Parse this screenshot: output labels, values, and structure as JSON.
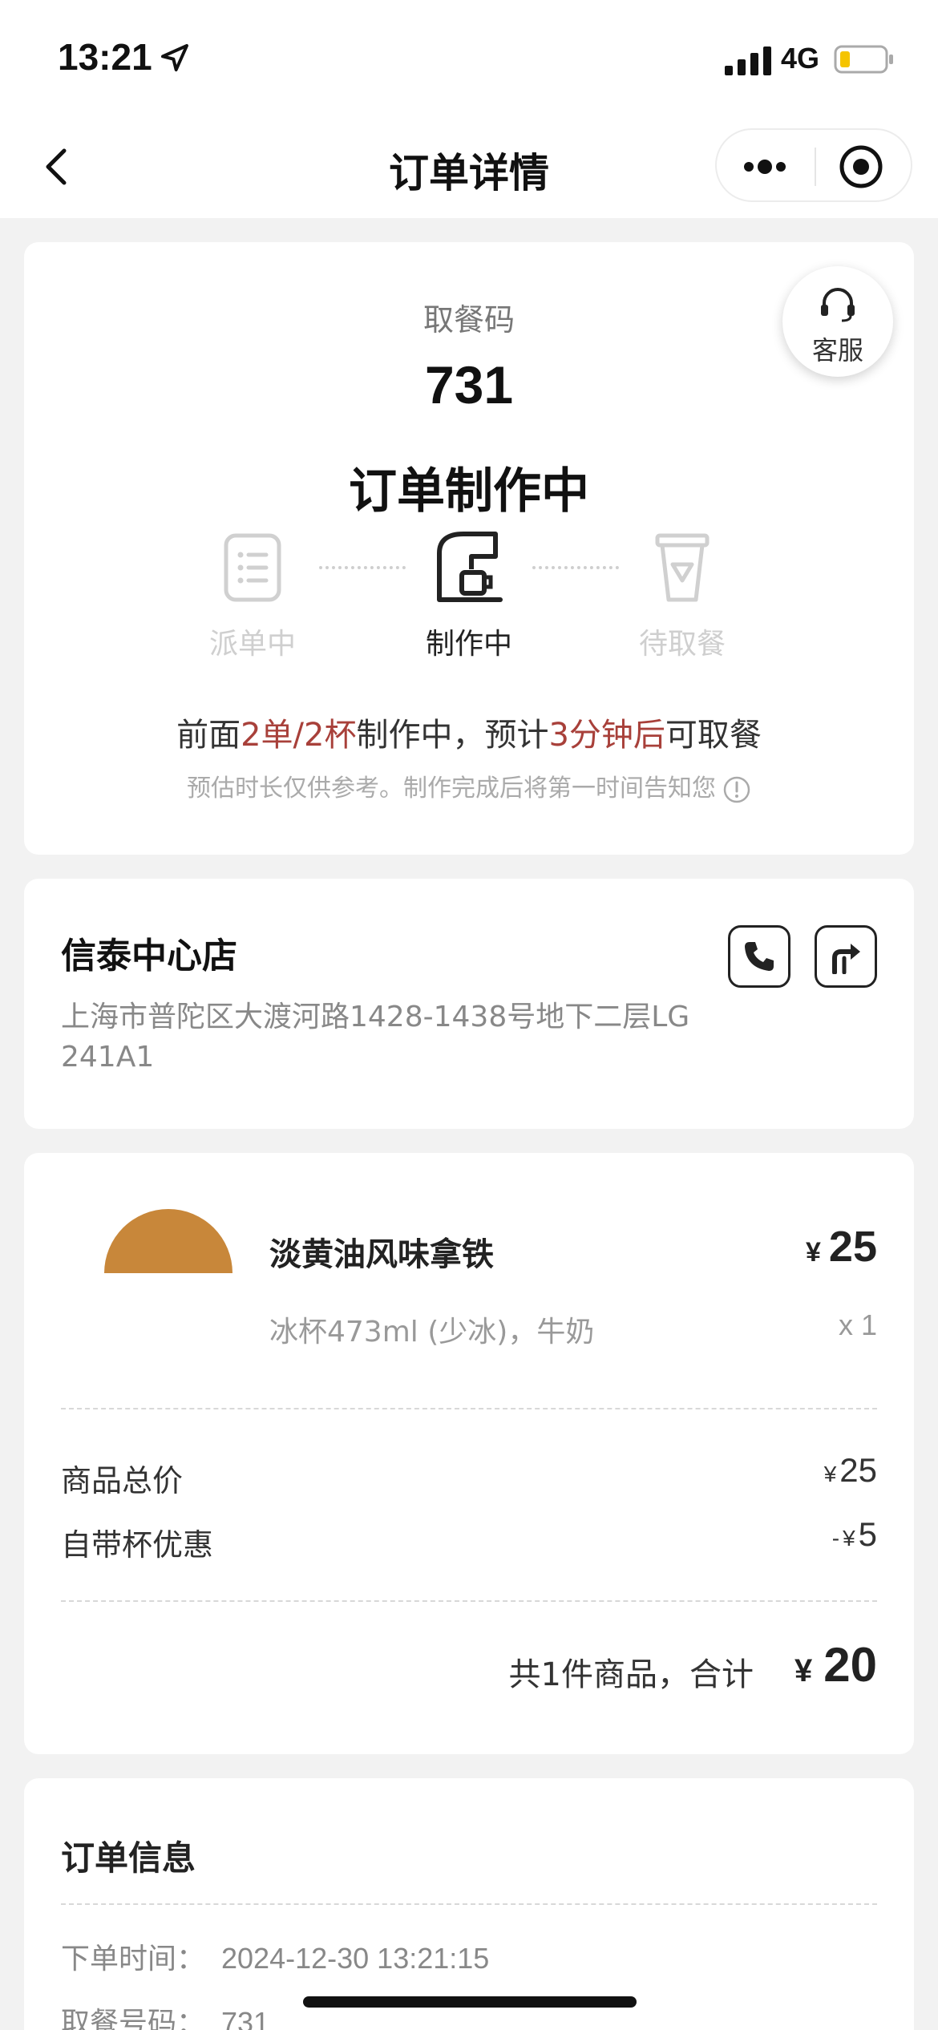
{
  "status_bar": {
    "time": "13:21",
    "network": "4G"
  },
  "nav": {
    "title": "订单详情"
  },
  "status_card": {
    "service_label": "客服",
    "pickup_label": "取餐码",
    "pickup_code": "731",
    "status": "订单制作中",
    "steps": [
      {
        "label": "派单中",
        "active": false
      },
      {
        "label": "制作中",
        "active": true
      },
      {
        "label": "待取餐",
        "active": false
      }
    ],
    "queue": {
      "p1": "前面",
      "orders": "2单/2杯",
      "p2": "制作中，预计",
      "eta": "3分钟后",
      "p3": "可取餐"
    },
    "note": "预估时长仅供参考。制作完成后将第一时间告知您"
  },
  "store": {
    "name": "信泰中心店",
    "address": "上海市普陀区大渡河路1428-1438号地下二层LG 241A1"
  },
  "product": {
    "name": "淡黄油风味拿铁",
    "currency": "¥",
    "price": "25",
    "spec": "冰杯473ml (少冰)，牛奶",
    "qty": "x 1"
  },
  "summary": {
    "subtotal_label": "商品总价",
    "subtotal": "25",
    "discount_label": "自带杯优惠",
    "discount_prefix": "-",
    "discount": "5",
    "total_text": "共1件商品，合计",
    "total": "20"
  },
  "order_info": {
    "title": "订单信息",
    "time_label": "下单时间：",
    "time": "2024-12-30 13:21:15",
    "code_label": "取餐号码：",
    "code": "731"
  },
  "colors": {
    "highlight": "#a8403a",
    "step_inactive": "#d0d0d0",
    "step_active": "#222222"
  }
}
